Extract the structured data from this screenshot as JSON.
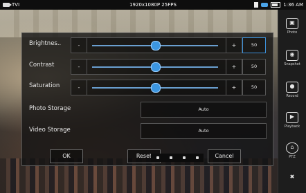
{
  "status_bar": {
    "channel": "TVI",
    "resolution": "1920x1080P 25FPS",
    "time": "1:36 AM"
  },
  "dialog": {
    "sliders": [
      {
        "label": "Brightnes..",
        "value": "50",
        "level_percent": 50
      },
      {
        "label": "Contrast",
        "value": "50",
        "level_percent": 50
      },
      {
        "label": "Saturation",
        "value": "50",
        "level_percent": 50
      }
    ],
    "photo_storage": {
      "label": "Photo Storage",
      "value": "Auto"
    },
    "video_storage": {
      "label": "Video Storage",
      "value": "Auto"
    },
    "buttons": {
      "ok": "OK",
      "reset": "Reset",
      "cancel": "Cancel"
    }
  },
  "sidebar": {
    "items": [
      {
        "label": "Photo",
        "icon": "image-icon"
      },
      {
        "label": "Snapshot",
        "icon": "camera-icon"
      },
      {
        "label": "Record",
        "icon": "record-icon"
      },
      {
        "label": "Playback",
        "icon": "play-icon"
      },
      {
        "label": "PTZ",
        "icon": "ptz-icon"
      },
      {
        "label": "",
        "icon": "tools-icon"
      }
    ]
  },
  "colors": {
    "accent": "#3c96e0",
    "dialog_bg": "#141414"
  }
}
